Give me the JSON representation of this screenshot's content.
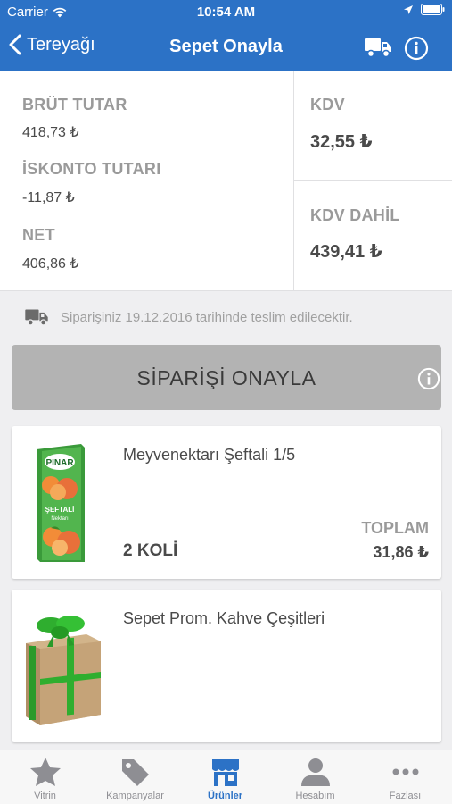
{
  "status_bar": {
    "carrier": "Carrier",
    "time": "10:54 AM"
  },
  "nav": {
    "back_label": "Tereyağı",
    "title": "Sepet Onayla",
    "icons": [
      "truck-icon",
      "info-icon"
    ]
  },
  "summary": {
    "brut_label": "BRÜT TUTAR",
    "brut_value": "418,73 ₺",
    "iskonto_label": "İSKONTO TUTARI",
    "iskonto_value": "-11,87 ₺",
    "net_label": "NET",
    "net_value": "406,86 ₺",
    "kdv_label": "KDV",
    "kdv_value": "32,55 ₺",
    "kdv_dahil_label": "KDV DAHİL",
    "kdv_dahil_value": "439,41 ₺"
  },
  "delivery": {
    "text": "Siparişiniz 19.12.2016 tarihinde teslim edilecektir."
  },
  "confirm_button": {
    "label": "SİPARİŞİ ONAYLA"
  },
  "products": [
    {
      "name": "Meyvenektarı Şeftali 1/5",
      "quantity": "2 KOLİ",
      "total_label": "TOPLAM",
      "total_value": "31,86 ₺",
      "image": "juice-carton",
      "brand": "PINAR",
      "flavor": "ŞEFTALİ",
      "sub": "Nektarı"
    },
    {
      "name": "Sepet Prom. Kahve Çeşitleri",
      "image": "gift-box"
    }
  ],
  "tabs": [
    {
      "label": "Vitrin",
      "icon": "star-icon"
    },
    {
      "label": "Kampanyalar",
      "icon": "tag-icon"
    },
    {
      "label": "Ürünler",
      "icon": "store-icon",
      "active": true
    },
    {
      "label": "Hesabım",
      "icon": "person-icon"
    },
    {
      "label": "Fazlası",
      "icon": "more-icon"
    }
  ],
  "colors": {
    "brand_blue": "#2c72c6",
    "button_gray": "#b3b3b3",
    "label_gray": "#9a9a9a",
    "text_dark": "#4a4a4a",
    "gift_ribbon": "#2fae2f"
  }
}
